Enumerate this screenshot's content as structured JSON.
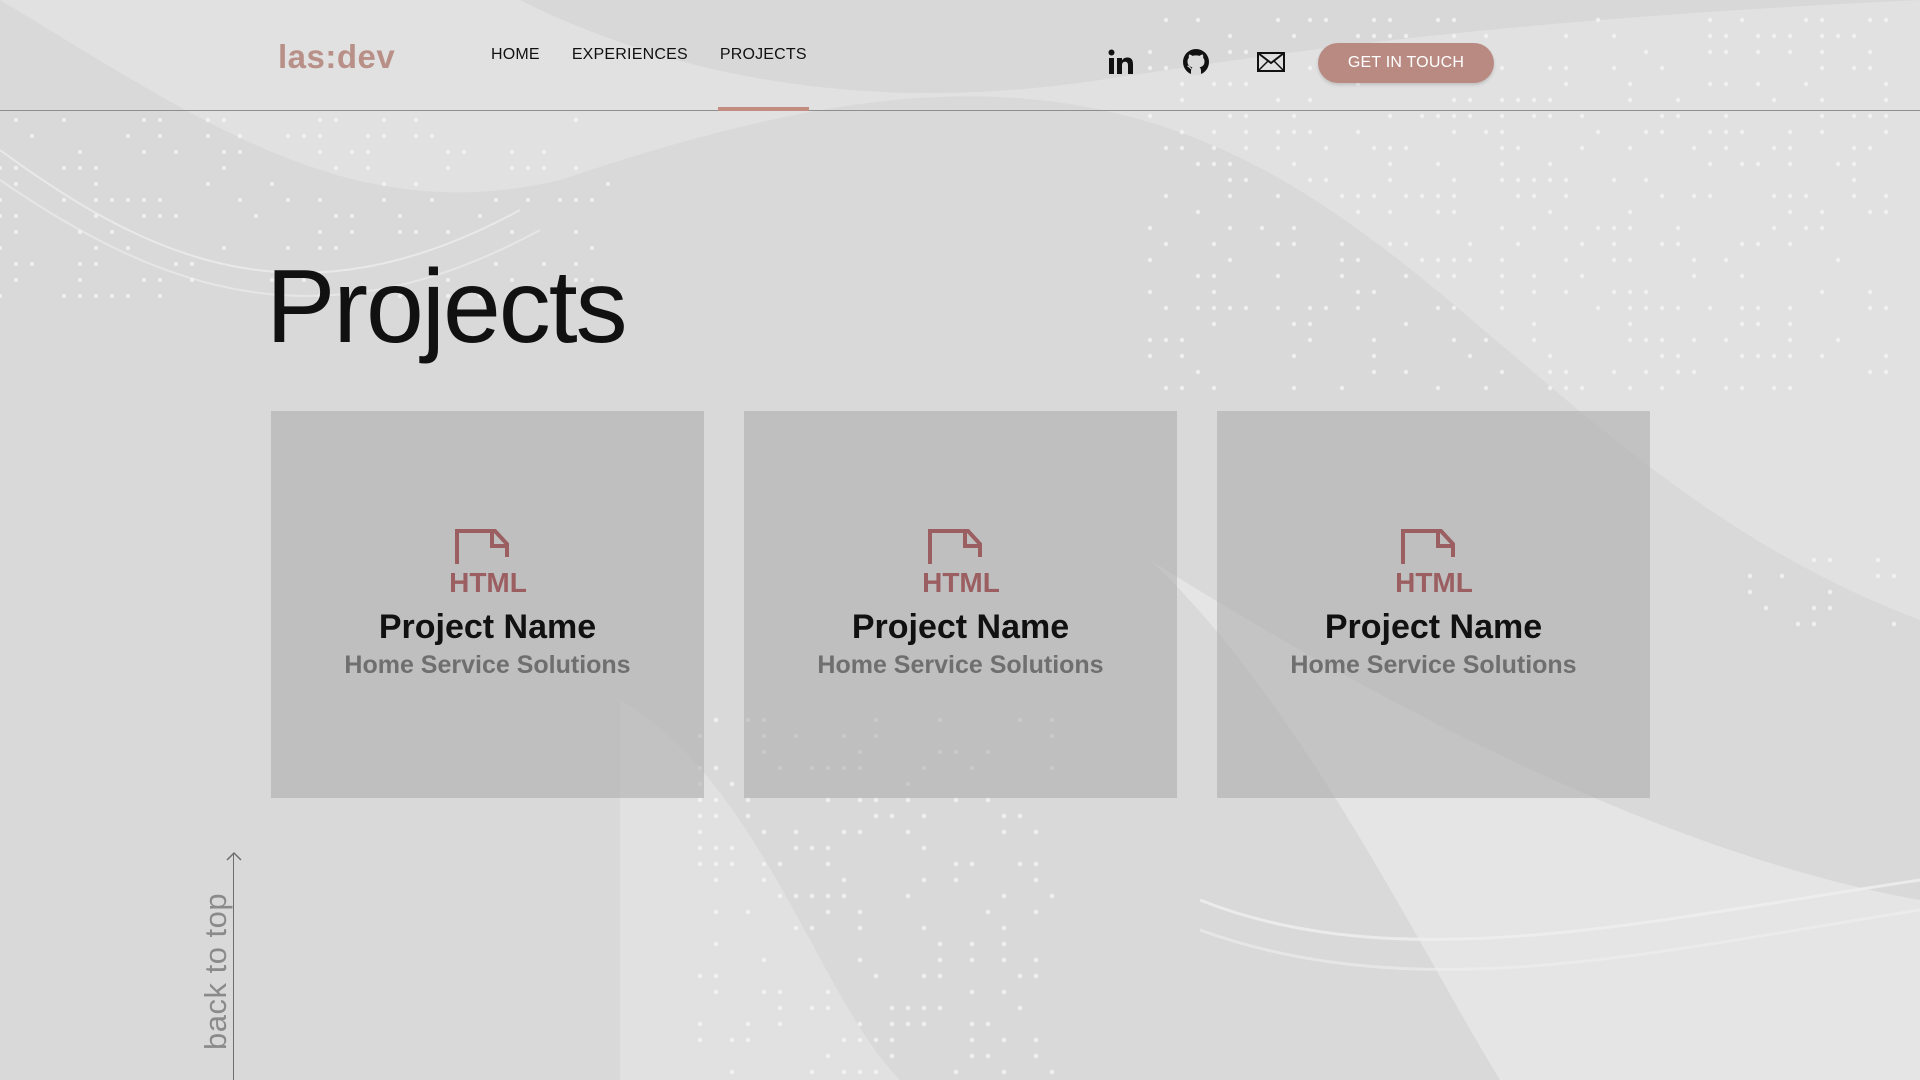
{
  "header": {
    "logo": "las:dev",
    "nav": [
      {
        "label": "HOME",
        "active": false
      },
      {
        "label": "EXPERIENCES",
        "active": false
      },
      {
        "label": "PROJECTS",
        "active": true
      }
    ],
    "social_icons": [
      "linkedin-icon",
      "github-icon",
      "mail-icon"
    ],
    "cta_label": "GET IN TOUCH"
  },
  "main": {
    "title": "Projects",
    "cards": [
      {
        "icon_text": "HTML",
        "name": "Project Name",
        "subtitle": "Home Service Solutions"
      },
      {
        "icon_text": "HTML",
        "name": "Project Name",
        "subtitle": "Home Service Solutions"
      },
      {
        "icon_text": "HTML",
        "name": "Project Name",
        "subtitle": "Home Service Solutions"
      }
    ]
  },
  "back_to_top": "back to top",
  "colors": {
    "accent": "#b98a82",
    "logo": "#b89088",
    "icon": "#9b5f62",
    "background": "#dadada"
  }
}
